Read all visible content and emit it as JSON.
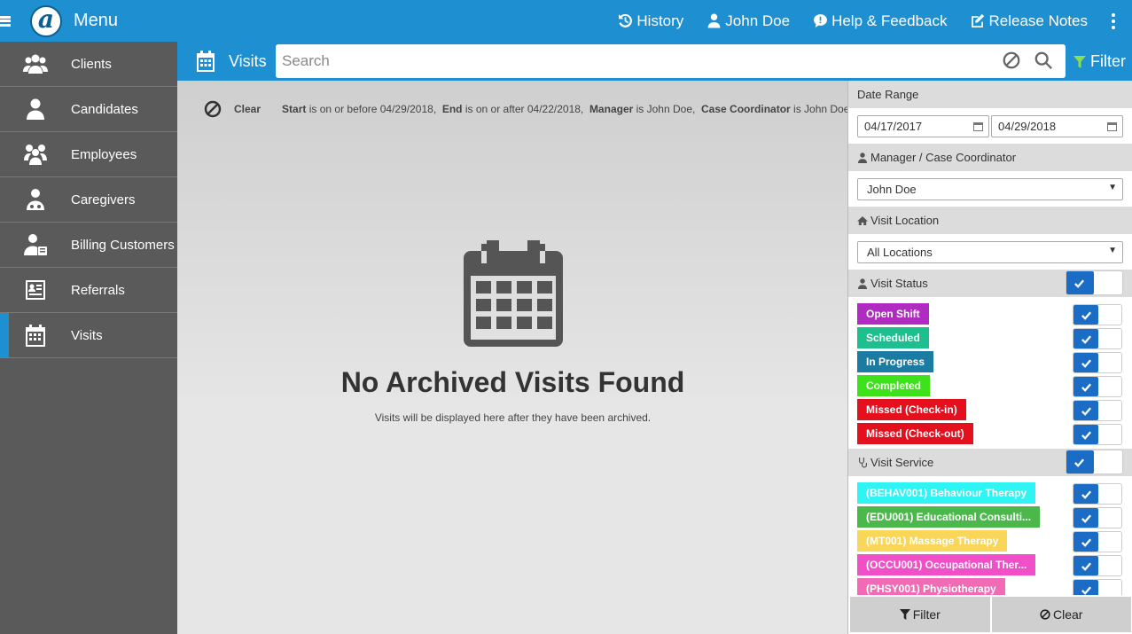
{
  "topbar": {
    "menu_label": "Menu",
    "logo_letter": "a",
    "links": {
      "history": "History",
      "user": "John Doe",
      "help": "Help & Feedback",
      "release_notes": "Release Notes"
    }
  },
  "sidebar": {
    "items": [
      {
        "label": "Clients",
        "icon": "users-icon"
      },
      {
        "label": "Candidates",
        "icon": "user-icon"
      },
      {
        "label": "Employees",
        "icon": "employees-icon"
      },
      {
        "label": "Caregivers",
        "icon": "caregiver-icon"
      },
      {
        "label": "Billing Customers",
        "icon": "billing-icon"
      },
      {
        "label": "Referrals",
        "icon": "referrals-icon"
      },
      {
        "label": "Visits",
        "icon": "calendar-icon",
        "active": true
      }
    ]
  },
  "subheader": {
    "title": "Visits",
    "search_placeholder": "Search",
    "filter_label": "Filter"
  },
  "criteria": {
    "clear_label": "Clear",
    "items": [
      {
        "field": "Start",
        "text": " is on or before 04/29/2018,"
      },
      {
        "field": "End",
        "text": " is on or after 04/22/2018,"
      },
      {
        "field": "Manager",
        "text": " is John Doe,"
      },
      {
        "field": "Case Coordinator",
        "text": " is John Doe"
      }
    ]
  },
  "empty_state": {
    "title": "No Archived Visits Found",
    "subtitle": "Visits will be displayed here after they have been archived."
  },
  "filter_panel": {
    "date_range": {
      "label": "Date Range",
      "start": "04/17/2017",
      "end": "04/29/2018"
    },
    "manager": {
      "label": "Manager / Case Coordinator",
      "value": "John Doe"
    },
    "location": {
      "label": "Visit Location",
      "value": "All Locations"
    },
    "visit_status": {
      "label": "Visit Status",
      "items": [
        {
          "label": "Open Shift",
          "color": "#b02bc0"
        },
        {
          "label": "Scheduled",
          "color": "#1dbf8f"
        },
        {
          "label": "In Progress",
          "color": "#1c7ba3"
        },
        {
          "label": "Completed",
          "color": "#3de21a"
        },
        {
          "label": "Missed (Check-in)",
          "color": "#e5101e"
        },
        {
          "label": "Missed (Check-out)",
          "color": "#e5101e"
        }
      ]
    },
    "visit_service": {
      "label": "Visit Service",
      "items": [
        {
          "label": "(BEHAV001) Behaviour Therapy",
          "color": "#2ef4f4"
        },
        {
          "label": "(EDU001) Educational Consulti...",
          "color": "#4cb84c"
        },
        {
          "label": "(MT001) Massage Therapy",
          "color": "#f9d657"
        },
        {
          "label": "(OCCU001) Occupational Ther...",
          "color": "#f04fc8"
        },
        {
          "label": "(PHSY001) Physiotherapy",
          "color": "#f06ab5"
        }
      ]
    },
    "footer": {
      "filter": "Filter",
      "clear": "Clear"
    }
  },
  "colors": {
    "accent": "#1e8fd0",
    "sidebar": "#5a5a5a",
    "toggle_on": "#1a6cc4"
  }
}
